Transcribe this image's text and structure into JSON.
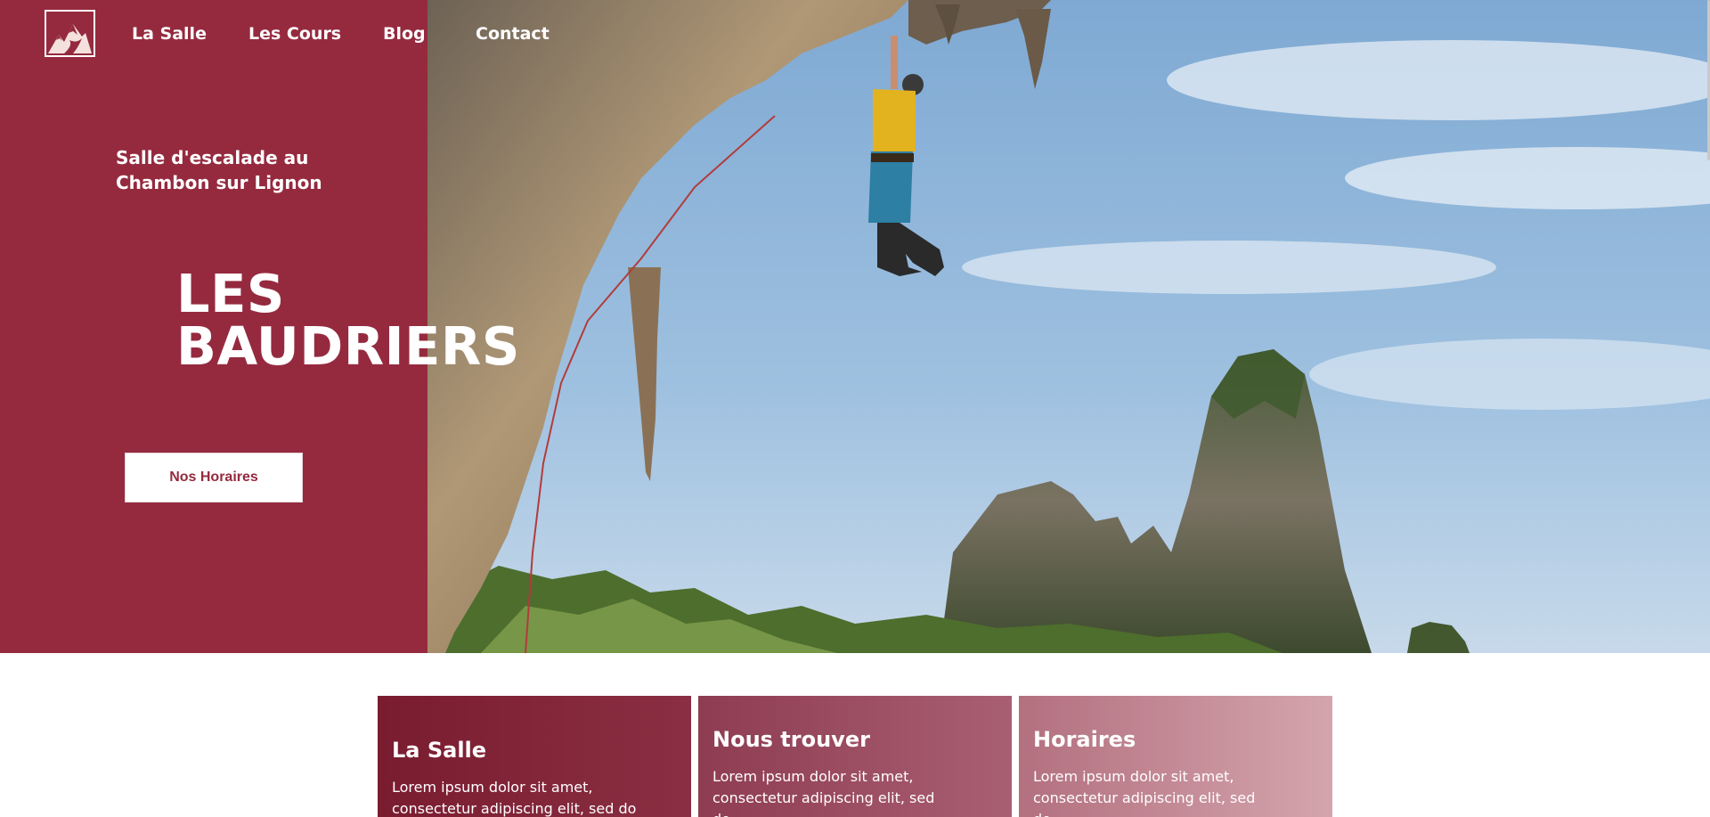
{
  "nav": {
    "items": [
      {
        "label": "La Salle"
      },
      {
        "label": "Les Cours"
      },
      {
        "label": "Blog"
      },
      {
        "label": "Contact"
      }
    ]
  },
  "hero": {
    "subtitle": "Salle d'escalade au Chambon sur Lignon",
    "title_line1": "LES",
    "title_line2": "BAUDRIERS",
    "cta_label": "Nos Horaires"
  },
  "cards": [
    {
      "title": "La Salle",
      "text": "Lorem ipsum dolor sit amet, consectetur adipiscing elit, sed do eiusmod tempor"
    },
    {
      "title": "Nous trouver",
      "text": "Lorem ipsum dolor sit amet, consectetur adipiscing elit, sed do"
    },
    {
      "title": "Horaires",
      "text": "Lorem ipsum dolor sit amet, consectetur adipiscing elit, sed do"
    }
  ],
  "colors": {
    "brand": "#952a3f",
    "white": "#ffffff"
  },
  "icons": {
    "logo": "mountain-logo-icon"
  }
}
